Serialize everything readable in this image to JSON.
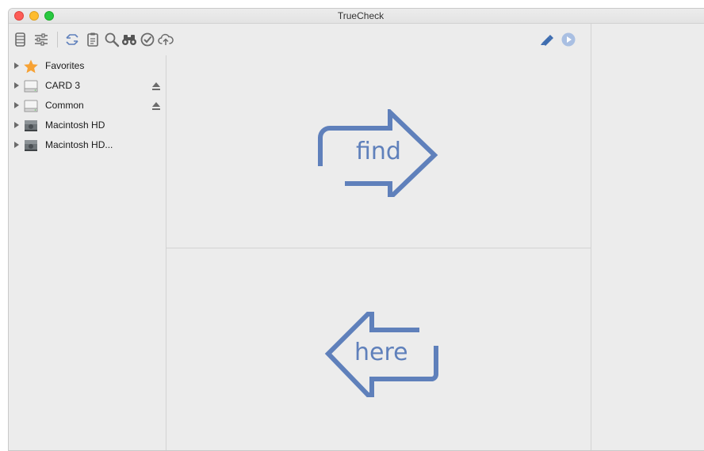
{
  "window": {
    "title": "TrueCheck"
  },
  "toolbar": {
    "icons": [
      "list-icon",
      "sliders-icon",
      "sync-arrows-icon",
      "clipboard-icon",
      "magnifier-icon",
      "binoculars-icon",
      "checkmark-circle-icon",
      "cloud-upload-icon",
      "eraser-icon",
      "play-circle-icon"
    ]
  },
  "sidebar": {
    "items": [
      {
        "label": "Favorites",
        "icon": "star-icon",
        "ejectable": false
      },
      {
        "label": "CARD 3",
        "icon": "drive-icon",
        "ejectable": true
      },
      {
        "label": "Common",
        "icon": "drive-icon",
        "ejectable": true
      },
      {
        "label": "Macintosh HD",
        "icon": "hard-disk-icon",
        "ejectable": false
      },
      {
        "label": "Macintosh HD...",
        "icon": "hard-disk-icon",
        "ejectable": false
      }
    ]
  },
  "panes": {
    "find_text": "find",
    "here_text": "here"
  },
  "colors": {
    "accent": "#5f80bb",
    "favorite_star": "#f7a234",
    "close": "#fd5d57",
    "minimize": "#febc2e",
    "maximize": "#28c840"
  }
}
